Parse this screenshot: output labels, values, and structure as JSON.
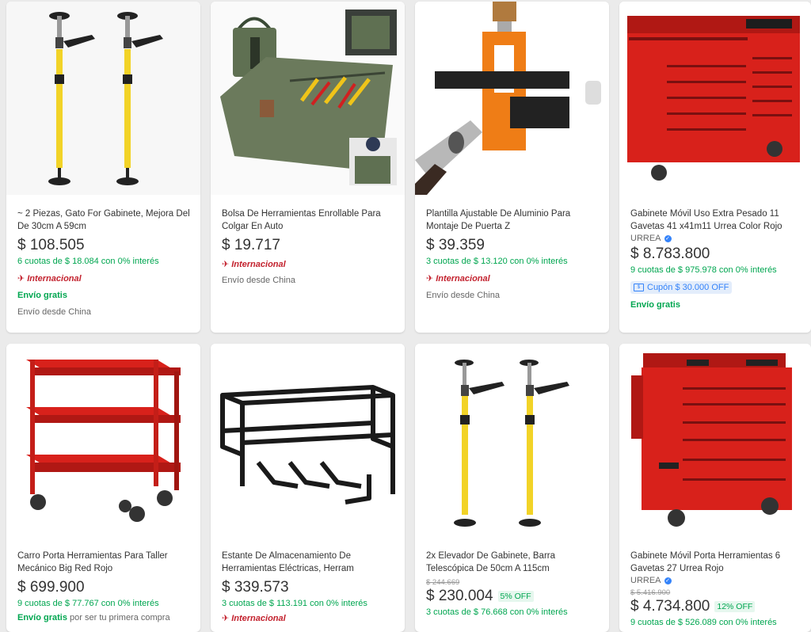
{
  "currency": "$",
  "products": [
    {
      "title": "~ 2 Piezas, Gato For Gabinete, Mejora Del De 30cm A 59cm",
      "price": "$ 108.505",
      "installments": "6 cuotas de $ 18.084 con 0% interés",
      "international": "Internacional",
      "shipping_free": "Envío gratis",
      "ships_from": "Envío desde China"
    },
    {
      "title": "Bolsa De Herramientas Enrollable Para Colgar En Auto",
      "price": "$ 19.717",
      "international": "Internacional",
      "ships_from": "Envío desde China"
    },
    {
      "title": "Plantilla Ajustable De Aluminio Para Montaje De Puerta Z",
      "price": "$ 39.359",
      "installments": "3 cuotas de $ 13.120 con 0% interés",
      "international": "Internacional",
      "ships_from": "Envío desde China"
    },
    {
      "title": "Gabinete Móvil Uso Extra Pesado 11 Gavetas 41 x41m11 Urrea Color Rojo",
      "brand": "URREA",
      "price": "$ 8.783.800",
      "installments": "9 cuotas de $ 975.978 con 0% interés",
      "coupon": "Cupón $ 30.000 OFF",
      "shipping_free": "Envío gratis"
    },
    {
      "title": "Carro Porta Herramientas Para Taller Mecánico Big Red Rojo",
      "price": "$ 699.900",
      "installments": "9 cuotas de $ 77.767 con 0% interés",
      "shipping_free": "Envío gratis",
      "shipping_note": "por ser tu primera compra"
    },
    {
      "title": "Estante De Almacenamiento De Herramientas Eléctricas, Herram",
      "price": "$ 339.573",
      "installments": "3 cuotas de $ 113.191 con 0% interés",
      "international": "Internacional"
    },
    {
      "title": "2x Elevador De Gabinete, Barra Telescópica De 50cm A 115cm",
      "old_price": "$ 244.669",
      "price": "$ 230.004",
      "discount": "5% OFF",
      "installments": "3 cuotas de $ 76.668 con 0% interés"
    },
    {
      "title": "Gabinete Móvil Porta Herramientas 6 Gavetas 27 Urrea Rojo",
      "brand": "URREA",
      "old_price": "$ 5.416.900",
      "price": "$ 4.734.800",
      "discount": "12% OFF",
      "installments": "9 cuotas de $ 526.089 con 0% interés"
    }
  ],
  "colors": {
    "green": "#00a650",
    "red_international": "#c3222e",
    "blue": "#3483fa",
    "product_red": "#d8211b",
    "pole_yellow": "#f2d327"
  }
}
